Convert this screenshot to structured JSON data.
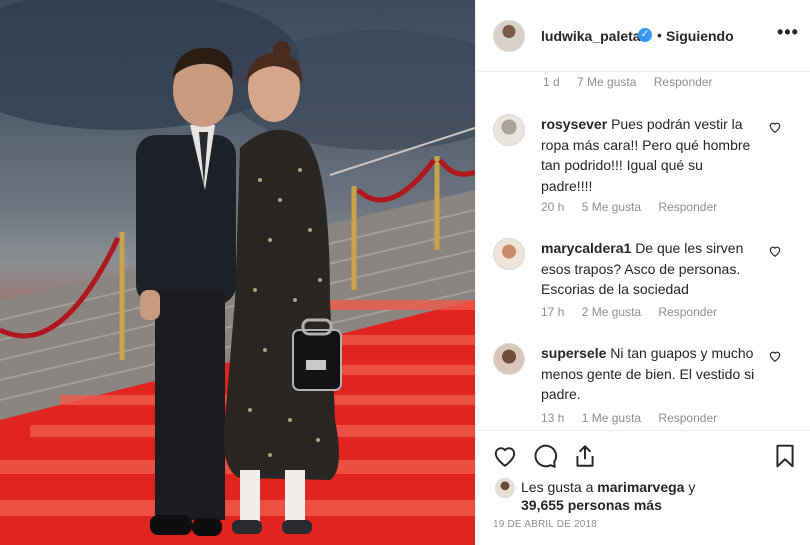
{
  "post": {
    "username": "ludwika_paleta",
    "verified_glyph": "✓",
    "separator": "•",
    "follow_label": "Siguiendo",
    "more_glyph": "•••"
  },
  "first_comment_meta": {
    "time": "1 d",
    "likes": "7 Me gusta",
    "reply": "Responder"
  },
  "comments": [
    {
      "user": "rosysever",
      "text": "Pues podrán vestir la ropa más cara!! Pero qué hombre tan podrido!!! Igual qué su padre!!!!",
      "time": "20 h",
      "likes": "5 Me gusta",
      "reply": "Responder"
    },
    {
      "user": "marycaldera1",
      "text": "De que les sirven esos trapos? Asco de personas. Escorias de la sociedad",
      "time": "17 h",
      "likes": "2 Me gusta",
      "reply": "Responder"
    },
    {
      "user": "supersele",
      "text": "Ni tan guapos y mucho menos gente de bien. El vestido si padre.",
      "time": "13 h",
      "likes": "1 Me gusta",
      "reply": "Responder"
    }
  ],
  "likes": {
    "prefix": "Les gusta a",
    "liker": "marimarvega",
    "connector": "y",
    "count": "39,655 personas más"
  },
  "date": "19 DE ABRIL DE 2018",
  "icons": [
    "heart-icon",
    "comment-icon",
    "share-icon",
    "bookmark-icon",
    "verified-icon",
    "more-icon"
  ],
  "colors": {
    "verified": "#3897f0",
    "secondary_text": "#8e8e8e",
    "divider": "#efefef"
  }
}
